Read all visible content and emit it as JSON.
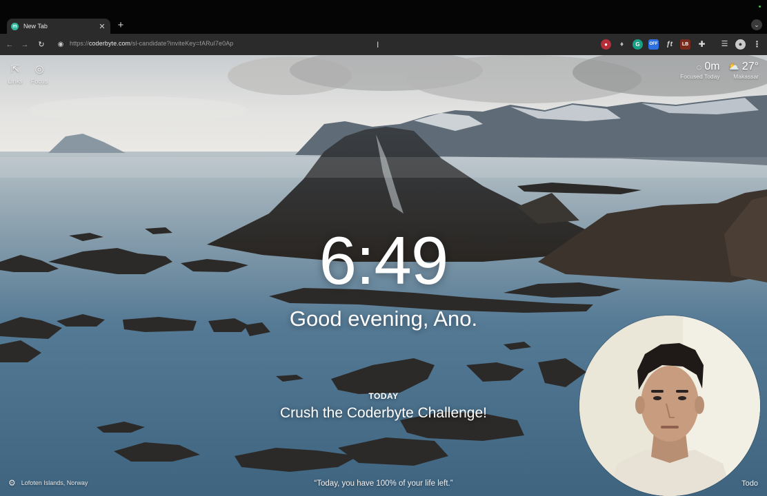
{
  "browser": {
    "tab": {
      "title": "New Tab",
      "favicon": "momentum-icon"
    },
    "url": {
      "scheme": "https://",
      "host": "coderbyte.com",
      "path": "/sl-candidate?inviteKey=fARul7e0Ap"
    },
    "extensions": {
      "ext4_badge": "OFF",
      "ext5_label": "ƒt",
      "ext6_label": "LB"
    }
  },
  "dashboard": {
    "links_label": "Links",
    "focus_label": "Focus",
    "focus_metric": {
      "value": "0m",
      "label": "Focused Today"
    },
    "weather": {
      "temperature": "27°",
      "location": "Makassar",
      "icon": "partly-cloudy-icon"
    },
    "clock": "6:49",
    "greeting": "Good evening, Ano.",
    "today_focus": {
      "label": "TODAY",
      "text": "Crush the Coderbyte Challenge!"
    },
    "photo_location": "Lofoten Islands, Norway",
    "quote": "“Today, you have 100% of your life left.”",
    "todo_label": "Todo"
  },
  "colors": {
    "tabstrip_bg": "#050505",
    "toolbar_bg": "#2b2b2b",
    "water": "#4a6b84",
    "sky": "#d9dbdc"
  }
}
